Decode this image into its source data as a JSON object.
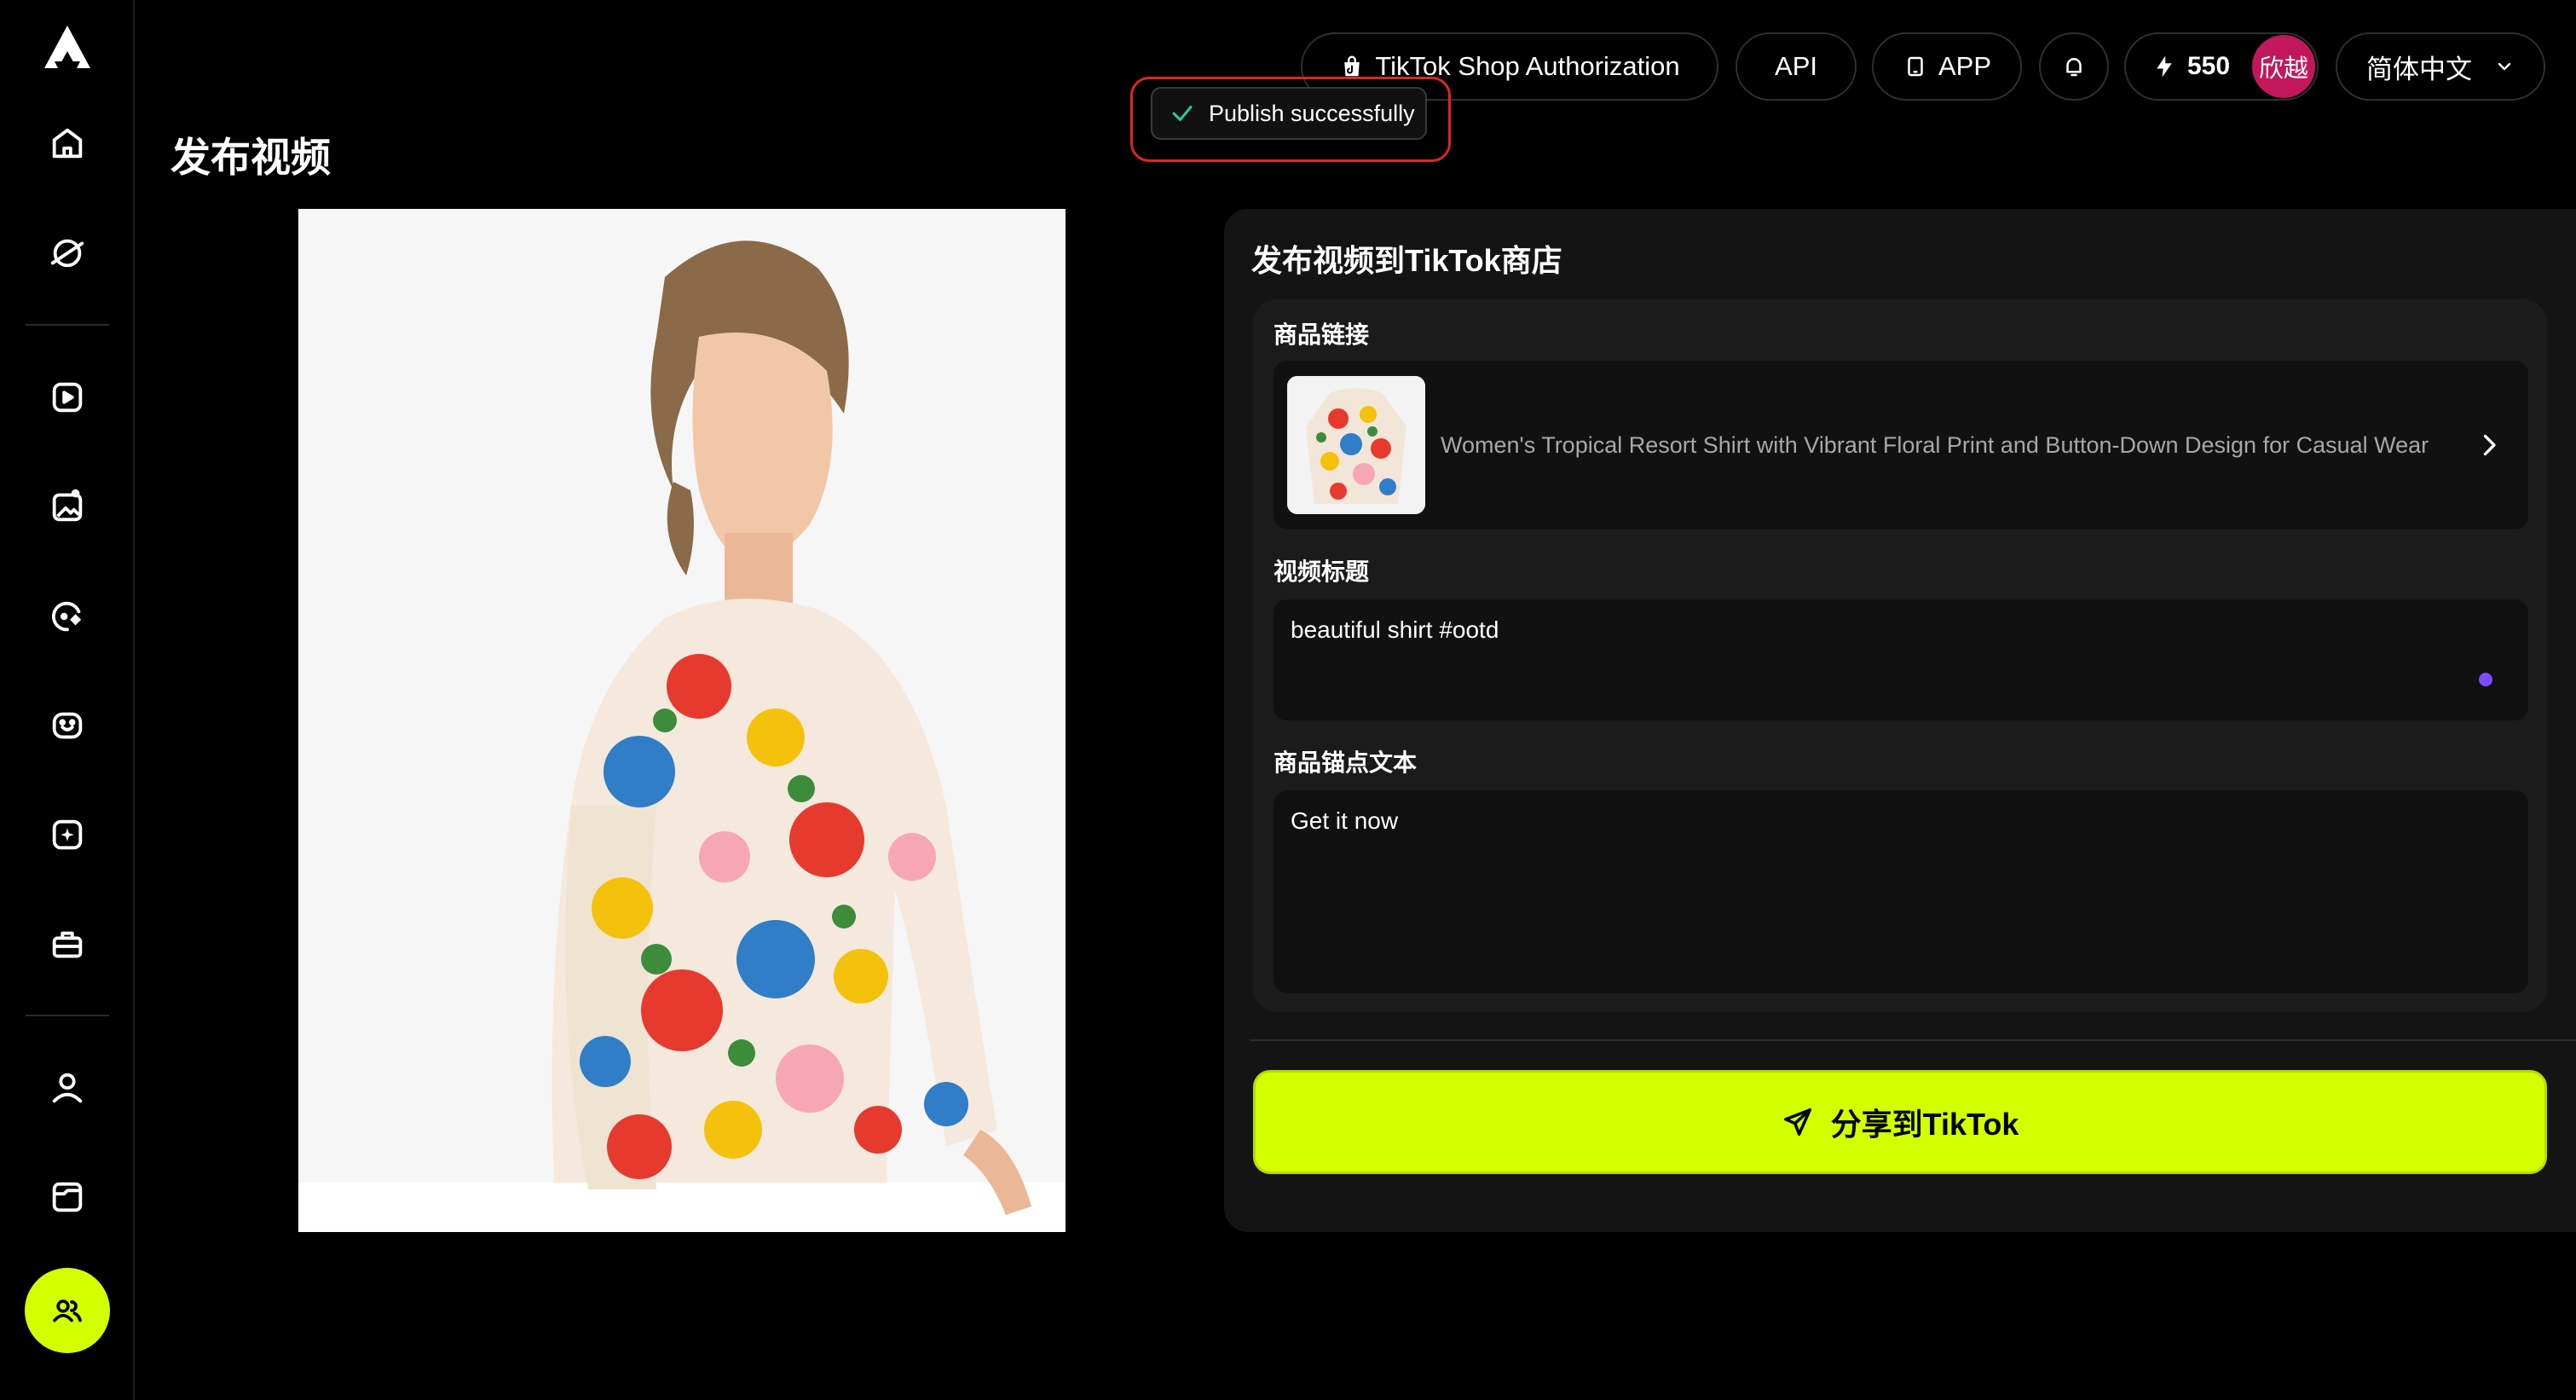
{
  "header": {
    "tiktok_shop_auth_label": "TikTok Shop Authorization",
    "api_label": "API",
    "app_label": "APP",
    "credits": "550",
    "avatar_text": "欣越",
    "language_label": "简体中文"
  },
  "toast": {
    "message": "Publish successfully"
  },
  "page": {
    "title": "发布视频"
  },
  "panel": {
    "title": "发布视频到TikTok商店",
    "product_link_label": "商品链接",
    "product_name": "Women's Tropical Resort Shirt with Vibrant Floral Print and Button-Down Design for Casual Wear",
    "video_title_label": "视频标题",
    "video_title_value": "beautiful shirt #ootd",
    "anchor_text_label": "商品锚点文本",
    "anchor_text_value": "Get it now",
    "share_button_label": "分享到TikTok"
  },
  "colors": {
    "accent": "#d4ff00",
    "avatar_bg": "#c2185b",
    "toast_outline": "#e02424",
    "indicator_dot": "#7c4dff"
  },
  "icons": {
    "sidebar": [
      "logo-icon",
      "home-icon",
      "discover-icon",
      "video-create-icon",
      "image-create-icon",
      "ai-edit-icon",
      "avatar-face-icon",
      "magic-icon",
      "toolbox-icon",
      "user-icon",
      "folder-icon",
      "team-icon"
    ],
    "header": [
      "shop-bag-icon",
      "tablet-icon",
      "bell-icon",
      "lightning-icon",
      "chevron-down-icon"
    ],
    "panel": [
      "chevron-right-icon",
      "send-icon",
      "check-icon"
    ]
  }
}
